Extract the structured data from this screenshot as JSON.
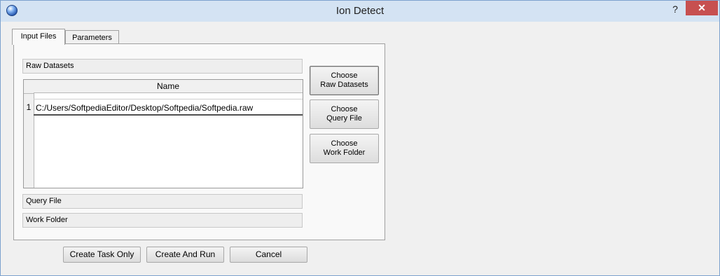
{
  "window": {
    "title": "Ion Detect",
    "help_label": "?",
    "close_label": "✕",
    "app_icon": "app-orb-icon"
  },
  "tabs": [
    {
      "label": "Input Files",
      "active": true
    },
    {
      "label": "Parameters",
      "active": false
    }
  ],
  "sections": {
    "raw_datasets": "Raw Datasets",
    "query_file": "Query File",
    "work_folder": "Work Folder"
  },
  "table": {
    "column_header": "Name",
    "rows": [
      {
        "index": "1",
        "name": "C:/Users/SoftpediaEditor/Desktop/Softpedia/Softpedia.raw"
      }
    ]
  },
  "side_buttons": {
    "raw_datasets": {
      "line1": "Choose",
      "line2": "Raw Datasets"
    },
    "query_file": {
      "line1": "Choose",
      "line2": "Query File"
    },
    "work_folder": {
      "line1": "Choose",
      "line2": "Work Folder"
    }
  },
  "bottom_buttons": {
    "create_task_only": "Create Task Only",
    "create_and_run": "Create And Run",
    "cancel": "Cancel"
  },
  "colors": {
    "titlebar": "#d4e3f3",
    "close_button": "#c75050",
    "window_bg": "#f0f0f0"
  }
}
